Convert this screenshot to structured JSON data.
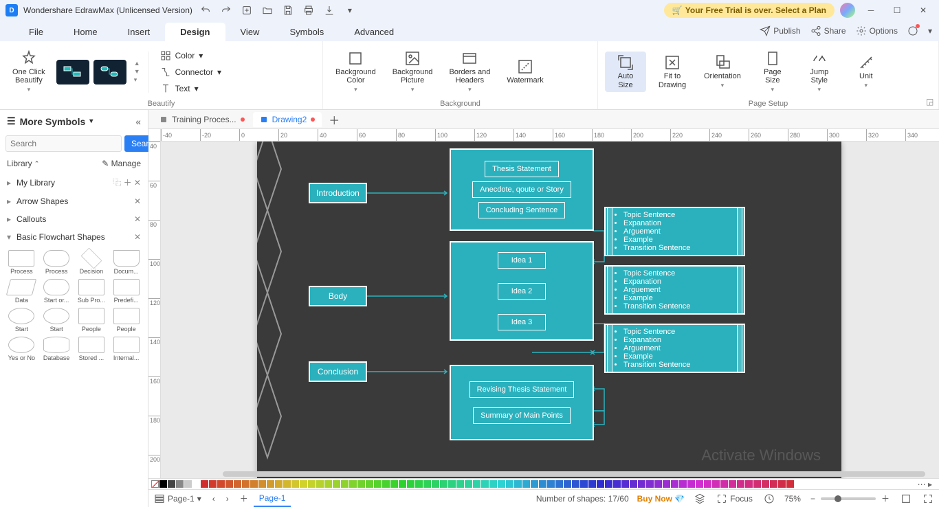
{
  "titlebar": {
    "app_title": "Wondershare EdrawMax (Unlicensed Version)",
    "trial_text": "Your Free Trial is over. Select a Plan"
  },
  "menubar": {
    "items": [
      "File",
      "Home",
      "Insert",
      "Design",
      "View",
      "Symbols",
      "Advanced"
    ],
    "active_index": 3,
    "right": {
      "publish": "Publish",
      "share": "Share",
      "options": "Options"
    }
  },
  "ribbon": {
    "beautify_btn": "One Click\nBeautify",
    "beautify_label": "Beautify",
    "color": "Color",
    "connector": "Connector",
    "text": "Text",
    "bg_color": "Background\nColor",
    "bg_pic": "Background\nPicture",
    "borders": "Borders and\nHeaders",
    "watermark": "Watermark",
    "bg_label": "Background",
    "auto_size": "Auto\nSize",
    "fit": "Fit to\nDrawing",
    "orientation": "Orientation",
    "page_size": "Page\nSize",
    "jump_style": "Jump\nStyle",
    "unit": "Unit",
    "page_setup_label": "Page Setup"
  },
  "tabs": [
    {
      "label": "Training Proces...",
      "active": false,
      "modified": true
    },
    {
      "label": "Drawing2",
      "active": true,
      "modified": true
    }
  ],
  "ruler_h": [
    -40,
    -20,
    0,
    20,
    40,
    60,
    80,
    100,
    120,
    140,
    160,
    180,
    200,
    220,
    240,
    260,
    280,
    300,
    320,
    340
  ],
  "ruler_v": [
    40,
    60,
    80,
    100,
    120,
    140,
    160,
    180,
    200
  ],
  "sidebar": {
    "title": "More Symbols",
    "search_placeholder": "Search",
    "search_btn": "Search",
    "library": "Library",
    "manage": "Manage",
    "categories": [
      {
        "label": "My Library",
        "actions": true
      },
      {
        "label": "Arrow Shapes",
        "close": true
      },
      {
        "label": "Callouts",
        "close": true
      },
      {
        "label": "Basic Flowchart Shapes",
        "expanded": true,
        "close": true
      }
    ],
    "shapes": [
      {
        "l": "Process",
        "c": ""
      },
      {
        "l": "Process",
        "c": "round"
      },
      {
        "l": "Decision",
        "c": "diamond"
      },
      {
        "l": "Docum...",
        "c": "doc"
      },
      {
        "l": "Data",
        "c": "parallel"
      },
      {
        "l": "Start or...",
        "c": "round"
      },
      {
        "l": "Sub Pro...",
        "c": ""
      },
      {
        "l": "Predefi...",
        "c": ""
      },
      {
        "l": "Start",
        "c": "ellipse"
      },
      {
        "l": "Start",
        "c": "ellipse"
      },
      {
        "l": "People",
        "c": ""
      },
      {
        "l": "People",
        "c": ""
      },
      {
        "l": "Yes or No",
        "c": "ellipse"
      },
      {
        "l": "Database",
        "c": "cyl"
      },
      {
        "l": "Stored ...",
        "c": ""
      },
      {
        "l": "Internal...",
        "c": ""
      }
    ]
  },
  "diagram": {
    "intro": {
      "label": "Introduction",
      "subs": [
        "Thesis Statement",
        "Anecdote, qoute or Story",
        "Concluding Sentence"
      ]
    },
    "body": {
      "label": "Body",
      "subs": [
        "Idea 1",
        "Idea 2",
        "Idea 3"
      ]
    },
    "conc": {
      "label": "Conclusion",
      "subs": [
        "Revising Thesis Statement",
        "Summary of Main Points"
      ]
    },
    "detail_items": [
      "Topic Sentence",
      "Expanation",
      "Arguement",
      "Example",
      "Transition Sentence"
    ]
  },
  "watermark_text": "Activate Windows",
  "status": {
    "page_dropdown": "Page-1",
    "page_tab": "Page-1",
    "shapes": "Number of shapes: 17/60",
    "buy": "Buy Now",
    "focus": "Focus",
    "zoom": "75%"
  }
}
